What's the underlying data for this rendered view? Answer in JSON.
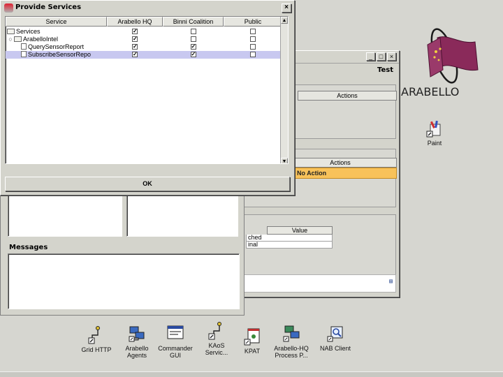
{
  "dialog": {
    "title": "Provide Services",
    "close_glyph": "×",
    "columns": [
      "Service",
      "Arabello HQ",
      "Binni Coalition",
      "Public"
    ],
    "rows": [
      {
        "label": "Services",
        "indent": 0,
        "kind": "node",
        "checks": [
          true,
          false,
          false
        ],
        "selected": false
      },
      {
        "label": "ArabelloIntel",
        "indent": 1,
        "kind": "node",
        "checks": [
          true,
          false,
          false
        ],
        "selected": false
      },
      {
        "label": "QuerySensorReport",
        "indent": 2,
        "kind": "leaf",
        "checks": [
          true,
          true,
          false
        ],
        "selected": false
      },
      {
        "label": "SubscribeSensorRepo",
        "indent": 2,
        "kind": "leaf",
        "checks": [
          true,
          true,
          false
        ],
        "selected": true
      }
    ],
    "ok_label": "OK"
  },
  "test_window": {
    "title": "Test",
    "top_header": "Actions",
    "mid_header": "Actions",
    "mid_action": "No Action",
    "value_header": "Value",
    "value_rows": [
      "ched",
      "inal"
    ]
  },
  "main_window": {
    "messages_label": "Messages"
  },
  "logo": {
    "word": "ARABELLO"
  },
  "desktop": {
    "paint": {
      "label": "Paint",
      "icon": "paint-icon"
    },
    "icons": [
      {
        "label1": "Grid HTTP",
        "label2": "",
        "icon": "shortcut-icon"
      },
      {
        "label1": "Arabello",
        "label2": "Agents",
        "icon": "network-computers-icon"
      },
      {
        "label1": "Commander",
        "label2": "GUI",
        "icon": "window-app-icon"
      },
      {
        "label1": "KAoS",
        "label2": "Servic...",
        "icon": "shortcut-icon"
      },
      {
        "label1": "KPAT",
        "label2": "",
        "icon": "kpat-icon"
      },
      {
        "label1": "Arabello-HQ",
        "label2": "Process P...",
        "icon": "network-computers-icon"
      },
      {
        "label1": "NAB Client",
        "label2": "",
        "icon": "magnifier-app-icon"
      }
    ]
  },
  "colors": {
    "desktop": "#d6d6d0",
    "selection": "#c8c8f0",
    "action_highlight": "#f8c25a",
    "logo_flag": "#8a2a5a"
  }
}
